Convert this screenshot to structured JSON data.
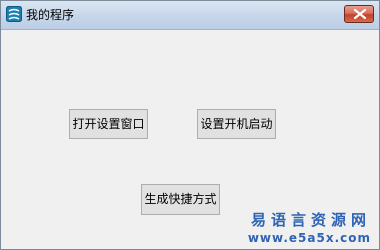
{
  "window": {
    "title": "我的程序",
    "icon": "app-logo-icon",
    "close_icon": "close-icon"
  },
  "buttons": {
    "open_settings": "打开设置窗口",
    "set_autostart": "设置开机启动",
    "create_shortcut": "生成快捷方式"
  },
  "watermark": {
    "title": "易语言资源网",
    "url": "www.e5a5x.com"
  },
  "colors": {
    "titlebar": "#c7d7ea",
    "client_bg": "#f0f0f0",
    "close_button": "#c2422a",
    "watermark": "#2f64b4"
  }
}
